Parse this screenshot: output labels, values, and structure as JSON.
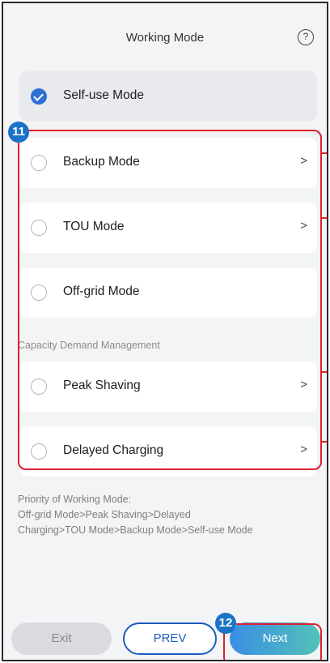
{
  "header": {
    "title": "Working Mode",
    "help_icon": "?"
  },
  "modes": [
    {
      "label": "Self-use Mode",
      "selected": true,
      "has_chevron": false
    },
    {
      "label": "Backup Mode",
      "selected": false,
      "has_chevron": true
    },
    {
      "label": "TOU Mode",
      "selected": false,
      "has_chevron": true
    },
    {
      "label": "Off-grid Mode",
      "selected": false,
      "has_chevron": false
    }
  ],
  "capacity": {
    "section_title": "Capacity Demand Management",
    "items": [
      {
        "label": "Peak Shaving",
        "selected": false,
        "has_chevron": true
      },
      {
        "label": "Delayed Charging",
        "selected": false,
        "has_chevron": true
      }
    ]
  },
  "priority_text": {
    "line1": "Priority of Working Mode:",
    "line2": "Off-grid Mode>Peak Shaving>Delayed",
    "line3": "Charging>TOU Mode>Backup Mode>Self-use Mode"
  },
  "chevron_glyph": ">",
  "footer": {
    "exit_label": "Exit",
    "prev_label": "PREV",
    "next_label": "Next"
  },
  "callouts": {
    "badge_11": "11",
    "badge_12": "12"
  },
  "colors": {
    "accent": "#2f6fd6",
    "callout": "#e0202c",
    "badge": "#1a73c8"
  }
}
